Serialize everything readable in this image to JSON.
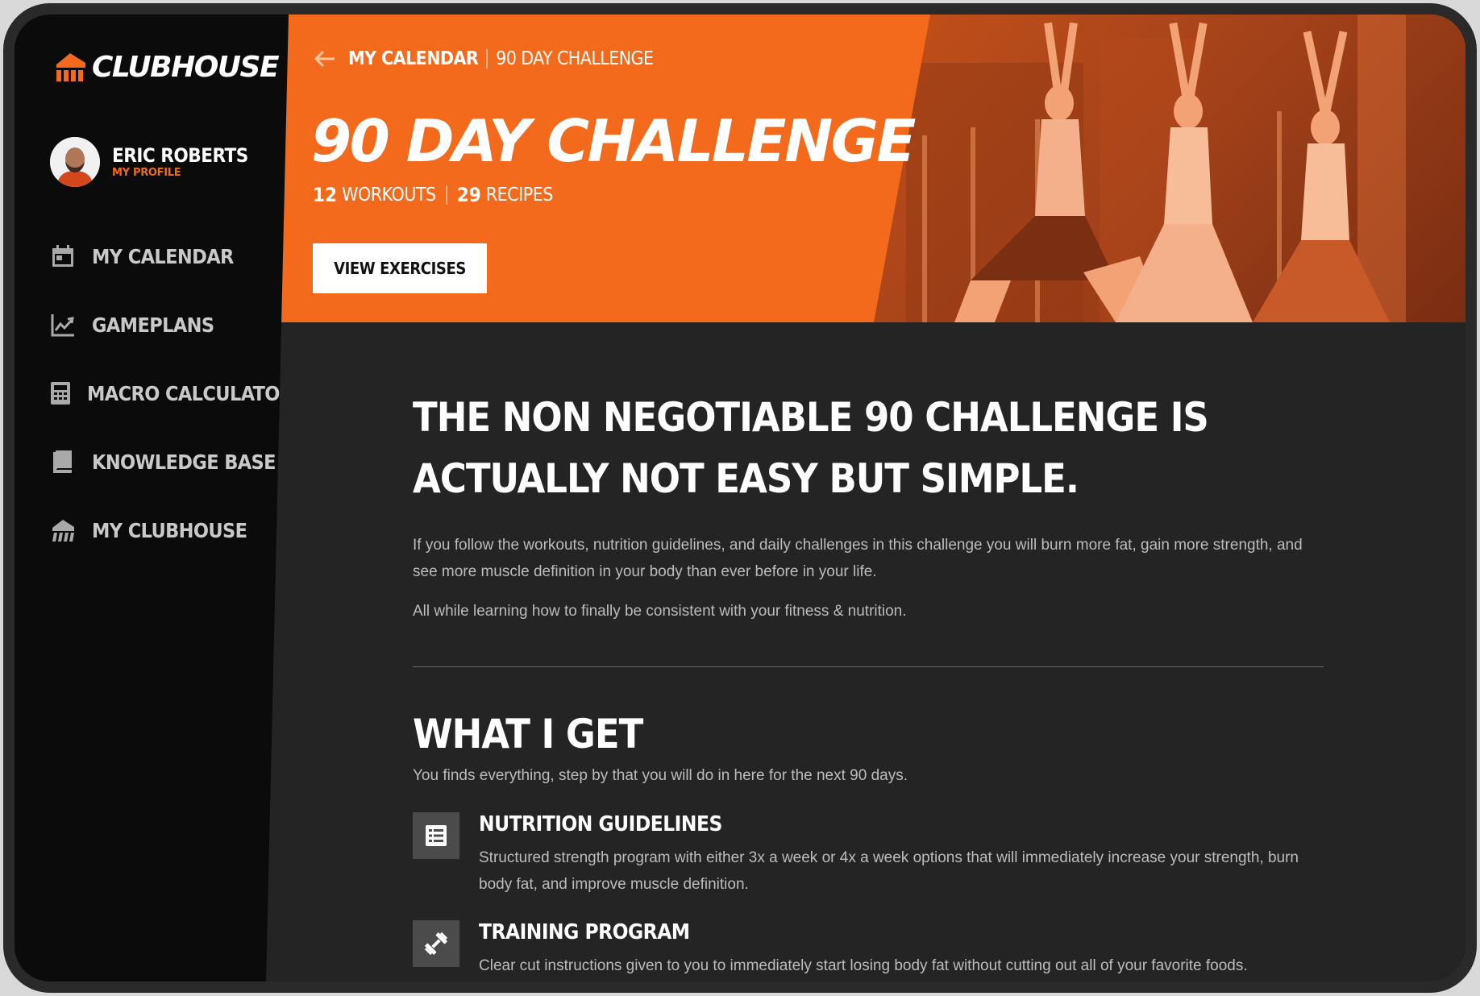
{
  "brand": {
    "name": "CLUBHOUSE",
    "accent_color": "#f36a1d"
  },
  "profile": {
    "name": "ERIC ROBERTS",
    "link_label": "MY PROFILE"
  },
  "sidebar": {
    "items": [
      {
        "label": "MY CALENDAR",
        "icon": "calendar-icon"
      },
      {
        "label": "GAMEPLANS",
        "icon": "chart-line-icon"
      },
      {
        "label": "MACRO CALCULATOR",
        "icon": "calculator-icon"
      },
      {
        "label": "KNOWLEDGE BASE",
        "icon": "book-icon"
      },
      {
        "label": "MY CLUBHOUSE",
        "icon": "clubhouse-icon"
      }
    ]
  },
  "hero": {
    "breadcrumb_parent": "MY CALENDAR",
    "breadcrumb_current": "90 DAY CHALLENGE",
    "title": "90 DAY CHALLENGE",
    "workouts_count": "12",
    "workouts_label": "WORKOUTS",
    "recipes_count": "29",
    "recipes_label": "RECIPES",
    "button_label": "VIEW EXERCISES"
  },
  "main": {
    "headline": "THE NON NEGOTIABLE 90 CHALLENGE IS ACTUALLY NOT EASY BUT SIMPLE.",
    "paragraph1": "If you follow the workouts, nutrition guidelines, and daily challenges in this challenge you will burn more fat, gain more strength, and see more muscle definition in your body than ever before in your life.",
    "paragraph2": "All while learning how to finally be consistent with your fitness & nutrition.",
    "section_title": "WHAT I GET",
    "section_subtitle": "You finds everything, step by that you will do in here for the next 90 days.",
    "features": [
      {
        "title": "NUTRITION GUIDELINES",
        "description": "Structured strength program with either 3x a week or 4x a week options that will immediately increase your strength, burn body fat, and improve muscle definition.",
        "icon": "list-icon"
      },
      {
        "title": "TRAINING PROGRAM",
        "description": "Clear cut instructions given to you to immediately start losing body fat without cutting out all of your favorite foods.",
        "icon": "dumbbell-icon"
      }
    ]
  }
}
